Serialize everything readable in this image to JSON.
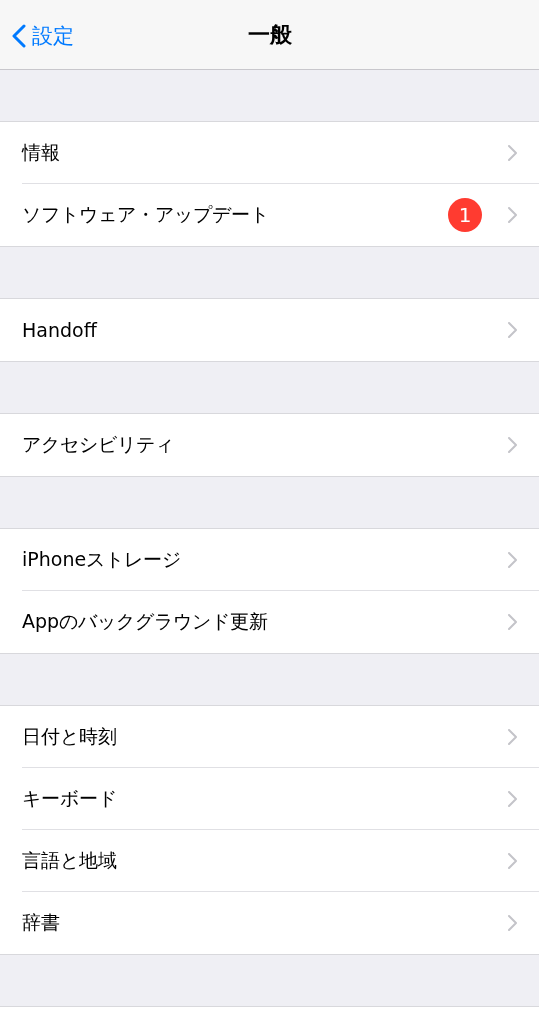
{
  "nav": {
    "back_label": "設定",
    "title": "一般"
  },
  "groups": [
    {
      "items": [
        {
          "label": "情報"
        },
        {
          "label": "ソフトウェア・アップデート",
          "badge": "1"
        }
      ]
    },
    {
      "items": [
        {
          "label": "Handoff"
        }
      ]
    },
    {
      "items": [
        {
          "label": "アクセシビリティ"
        }
      ]
    },
    {
      "items": [
        {
          "label": "iPhoneストレージ"
        },
        {
          "label": "Appのバックグラウンド更新"
        }
      ]
    },
    {
      "items": [
        {
          "label": "日付と時刻"
        },
        {
          "label": "キーボード"
        },
        {
          "label": "言語と地域"
        },
        {
          "label": "辞書"
        }
      ]
    }
  ]
}
